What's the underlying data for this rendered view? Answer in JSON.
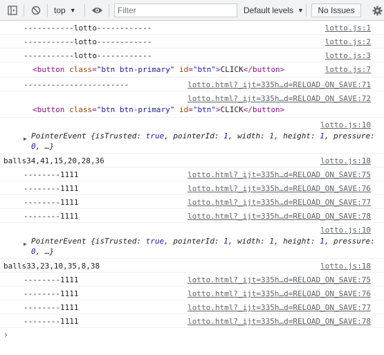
{
  "toolbar": {
    "context_label": "top",
    "filter_placeholder": "Filter",
    "levels_label": "Default levels",
    "issues_label": "No Issues"
  },
  "rows": [
    {
      "msg": "-----------lotto------------",
      "src": "lotto.js:1"
    },
    {
      "msg": "-----------lotto------------",
      "src": "lotto.js:2"
    },
    {
      "msg": "-----------lotto------------",
      "src": "lotto.js:3"
    },
    {
      "src": "lotto.js:7"
    },
    {
      "msg": "-----------------------",
      "src": "lotto.html?_ijt=335h…d=RELOAD_ON_SAVE:71"
    },
    {
      "src": "lotto.html?_ijt=335h…d=RELOAD_ON_SAVE:72"
    },
    {
      "src": "lotto.js:10"
    },
    {
      "msg": "balls34,41,15,20,28,36",
      "src": "lotto.js:18"
    },
    {
      "msg": "--------1111",
      "src": "lotto.html?_ijt=335h…d=RELOAD_ON_SAVE:75"
    },
    {
      "msg": "--------1111",
      "src": "lotto.html?_ijt=335h…d=RELOAD_ON_SAVE:76"
    },
    {
      "msg": "--------1111",
      "src": "lotto.html?_ijt=335h…d=RELOAD_ON_SAVE:77"
    },
    {
      "msg": "--------1111",
      "src": "lotto.html?_ijt=335h…d=RELOAD_ON_SAVE:78"
    },
    {
      "src": "lotto.js:10"
    },
    {
      "msg": "balls33,23,10,35,8,38",
      "src": "lotto.js:18"
    },
    {
      "msg": "--------1111",
      "src": "lotto.html?_ijt=335h…d=RELOAD_ON_SAVE:75"
    },
    {
      "msg": "--------1111",
      "src": "lotto.html?_ijt=335h…d=RELOAD_ON_SAVE:76"
    },
    {
      "msg": "--------1111",
      "src": "lotto.html?_ijt=335h…d=RELOAD_ON_SAVE:77"
    },
    {
      "msg": "--------1111",
      "src": "lotto.html?_ijt=335h…d=RELOAD_ON_SAVE:78"
    }
  ],
  "button_el": {
    "open": "<button",
    "class_attr": "class",
    "class_val": "\"btn btn-primary\"",
    "id_attr": "id",
    "id_val": "\"btn\"",
    "close_open": ">",
    "text": "CLICK",
    "close": "</button>"
  },
  "pointer_event": {
    "name": "PointerEvent",
    "line1_a": " {isTrusted: ",
    "line1_b": "true",
    "line1_c": ", pointerId: ",
    "line1_d": "1",
    "line1_e": ", width: ",
    "line1_f": "1",
    "line1_g": ", height: ",
    "line1_h": "1",
    "line1_i": ", pressure:",
    "line2_a": "0",
    "line2_b": ", …}"
  },
  "prompt_symbol": "›"
}
